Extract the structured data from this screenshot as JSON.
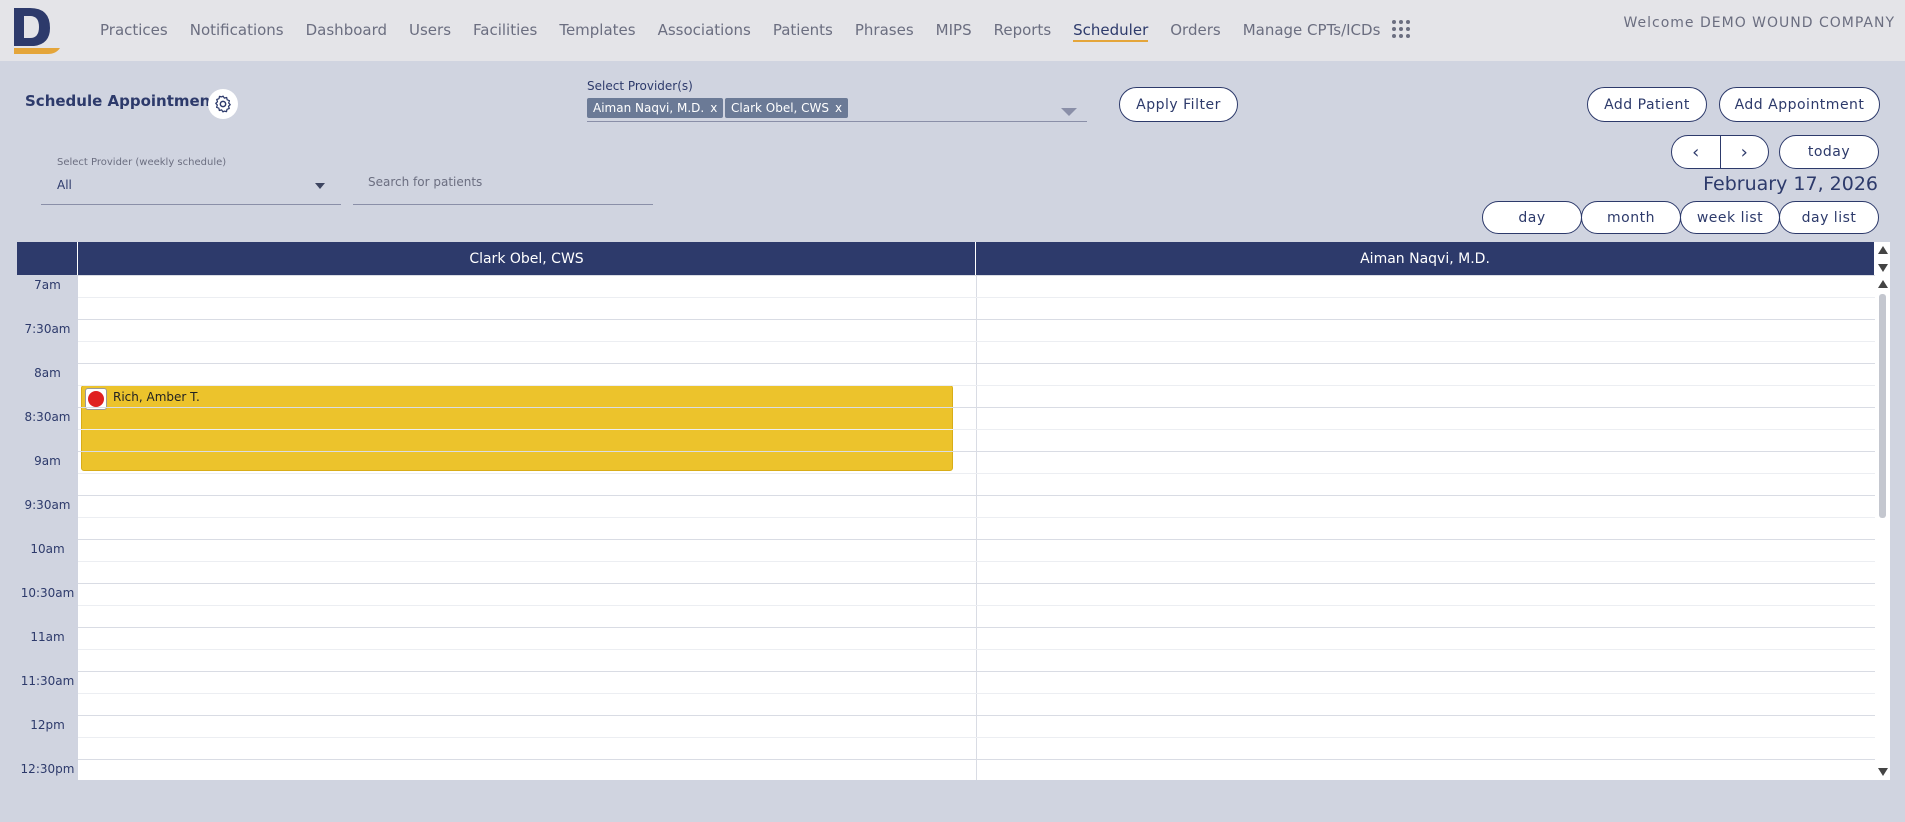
{
  "colors": {
    "navy": "#2d3a6b",
    "accent": "#e4a53a",
    "event_yellow": "#ecc32c",
    "status_red": "#e02020"
  },
  "nav": {
    "items": [
      "Practices",
      "Notifications",
      "Dashboard",
      "Users",
      "Facilities",
      "Templates",
      "Associations",
      "Patients",
      "Phrases",
      "MIPS",
      "Reports",
      "Scheduler",
      "Orders",
      "Manage CPTs/ICDs"
    ],
    "active": "Scheduler",
    "welcome": "Welcome DEMO WOUND COMPANY"
  },
  "toolbar": {
    "title": "Schedule Appointment",
    "provider_label": "Select Provider(s)",
    "chips": [
      "Aiman Naqvi, M.D.",
      "Clark Obel, CWS"
    ],
    "chip_remove": "x",
    "apply_filter": "Apply Filter",
    "add_patient": "Add Patient",
    "add_appointment": "Add Appointment",
    "weekly_label": "Select Provider (weekly schedule)",
    "weekly_value": "All",
    "search_placeholder": "Search for patients",
    "prev": "‹",
    "next": "›",
    "today": "today",
    "date": "February 17, 2026",
    "views": [
      "day",
      "month",
      "week list",
      "day list"
    ]
  },
  "calendar": {
    "resources": [
      "Clark Obel, CWS",
      "Aiman Naqvi, M.D."
    ],
    "times": [
      "7am",
      "7:30am",
      "8am",
      "8:30am",
      "9am",
      "9:30am",
      "10am",
      "10:30am",
      "11am",
      "11:30am",
      "12pm",
      "12:30pm"
    ],
    "events": [
      {
        "resource": 0,
        "title": "Rich, Amber T.",
        "start": "8:15am",
        "end": "9:15am",
        "status_color": "red"
      }
    ]
  }
}
